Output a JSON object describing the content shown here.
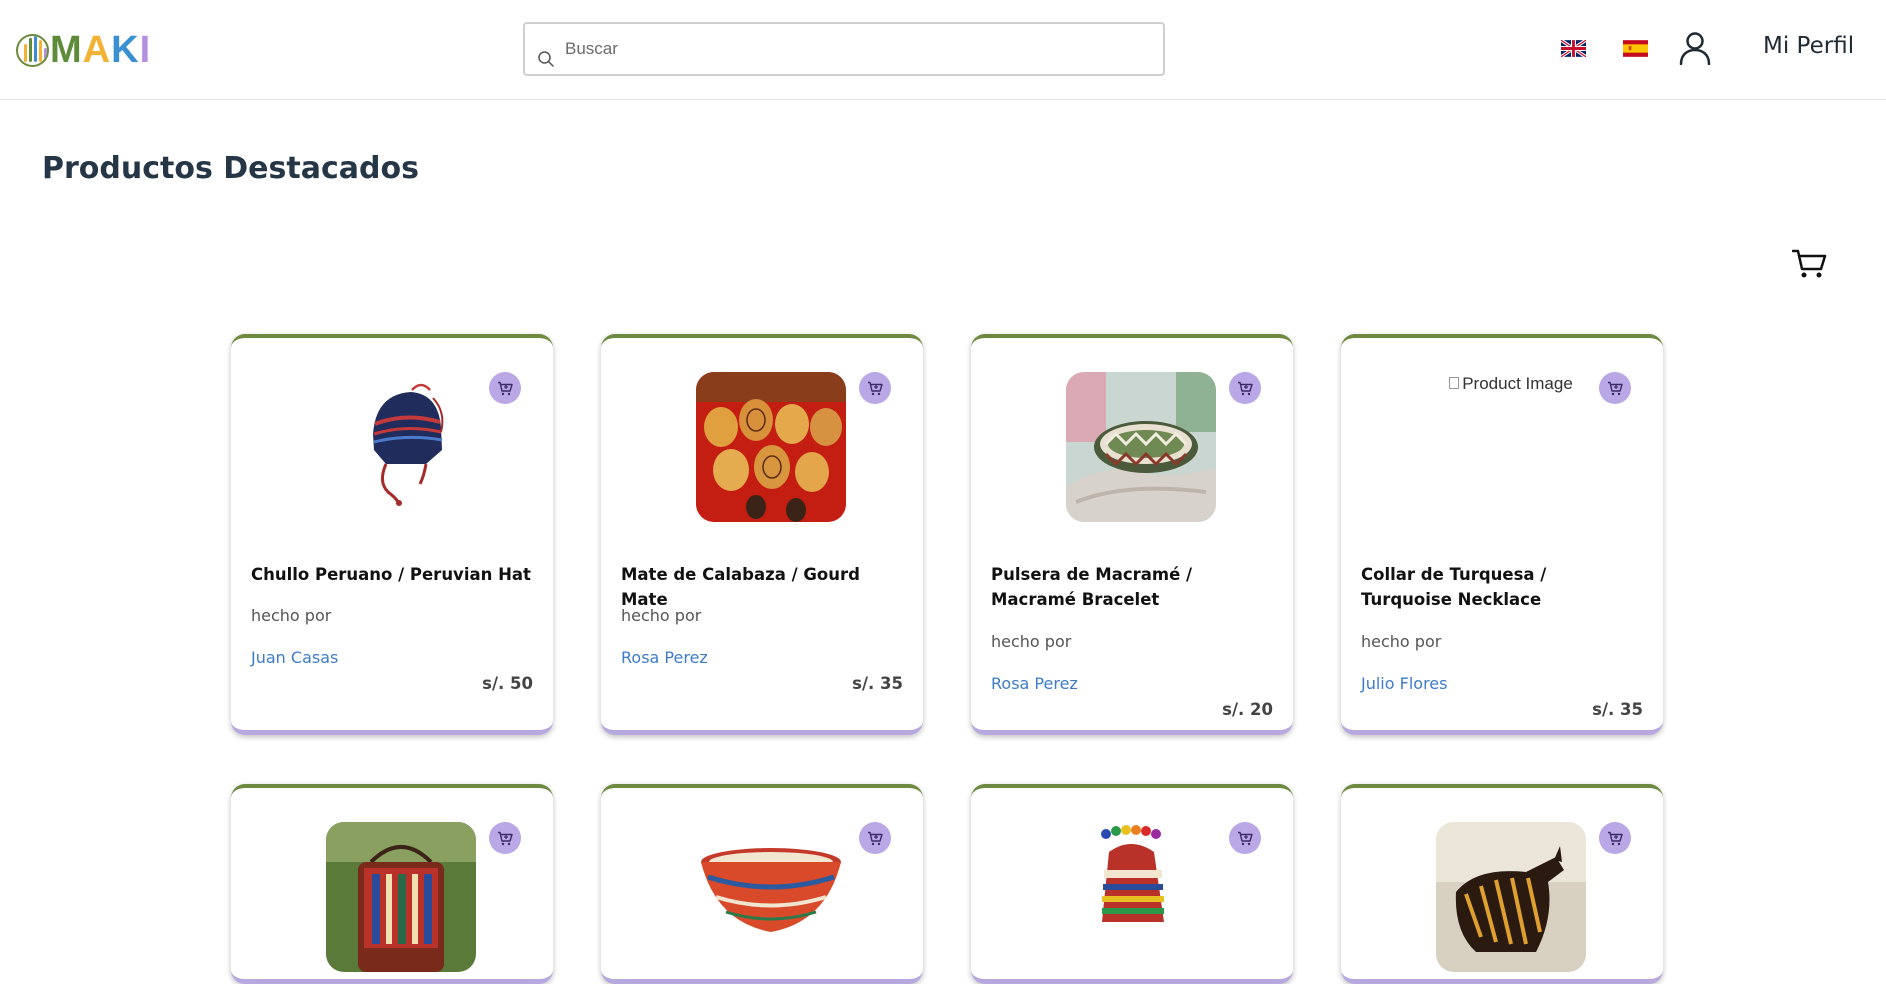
{
  "header": {
    "logo": {
      "letters": [
        "M",
        "A",
        "K",
        "I"
      ],
      "letter_colors": [
        "#5e8c3a",
        "#f2b234",
        "#3a8fd0",
        "#b48fe0"
      ]
    },
    "search": {
      "placeholder": "Buscar",
      "value": "",
      "icon": "search-icon"
    },
    "languages": [
      {
        "code": "en",
        "icon": "uk-flag-icon"
      },
      {
        "code": "es",
        "icon": "spain-flag-icon"
      }
    ],
    "user_icon": "user-icon",
    "profile_label": "Mi Perfil"
  },
  "page": {
    "title": "Productos Destacados",
    "cart_icon": "shopping-cart-icon"
  },
  "colors": {
    "card_top_border": "#6e8a40",
    "card_bottom_border": "#b8a8e0",
    "add_button": "#b9a7e6",
    "artisan_link": "#3d7cc9",
    "title": "#253746"
  },
  "products": [
    {
      "name": "Chullo Peruano / Peruvian Hat",
      "made_by_label": "hecho por",
      "artisan": "Juan Casas",
      "price": "s/. 50",
      "image": "chullo-hat"
    },
    {
      "name": "Mate de Calabaza / Gourd Mate",
      "made_by_label": "hecho por",
      "artisan": "Rosa Perez",
      "price": "s/. 35",
      "image": "gourd-mates"
    },
    {
      "name": "Pulsera de Macramé / Macramé Bracelet",
      "made_by_label": "hecho por",
      "artisan": "Rosa Perez",
      "price": "s/. 20",
      "image": "macrame-bracelet"
    },
    {
      "name": "Collar de Turquesa / Turquoise Necklace",
      "made_by_label": "hecho por",
      "artisan": "Julio Flores",
      "price": "s/. 35",
      "image_alt": "Product Image"
    },
    {
      "image": "woven-bag"
    },
    {
      "image": "painted-bowl"
    },
    {
      "image": "rainbow-chullo"
    },
    {
      "image": "ceramic-bull"
    }
  ]
}
